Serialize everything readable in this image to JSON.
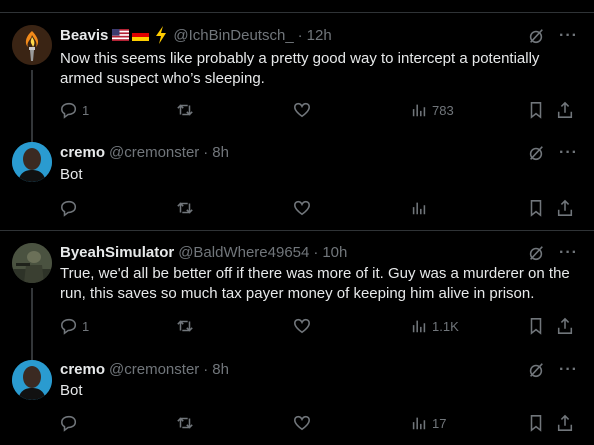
{
  "tweets": [
    {
      "name": "Beavis",
      "handle": "@IchBinDeutsch_",
      "time": "12h",
      "text": "Now this seems like probably a pretty good way to intercept a potentially armed suspect who’s sleeping.",
      "replies": "1",
      "retweets": "",
      "likes": "",
      "views": "783",
      "avatar_icon": "flaming-torch-avatar",
      "badges": [
        "us-flag-icon",
        "german-flag-icon",
        "lightning-bolt-icon"
      ]
    },
    {
      "name": "cremo",
      "handle": "@cremonster",
      "time": "8h",
      "text": "Bot",
      "replies": "",
      "retweets": "",
      "likes": "",
      "views": "",
      "avatar_icon": "person-avatar"
    },
    {
      "name": "ByeahSimulator",
      "handle": "@BaldWhere49654",
      "time": "10h",
      "text": "True, we'd all be better off if there was more of it. Guy was a murderer on the run, this saves so much tax payer money of keeping him alive in prison.",
      "replies": "1",
      "retweets": "",
      "likes": "",
      "views": "1.1K",
      "avatar_icon": "soldier-avatar"
    },
    {
      "name": "cremo",
      "handle": "@cremonster",
      "time": "8h",
      "text": "Bot",
      "replies": "",
      "retweets": "",
      "likes": "",
      "views": "17",
      "avatar_icon": "person-avatar"
    }
  ],
  "colors": {
    "background": "#000000",
    "text": "#e7e9ea",
    "muted": "#71767b",
    "divider": "#2f3336"
  }
}
